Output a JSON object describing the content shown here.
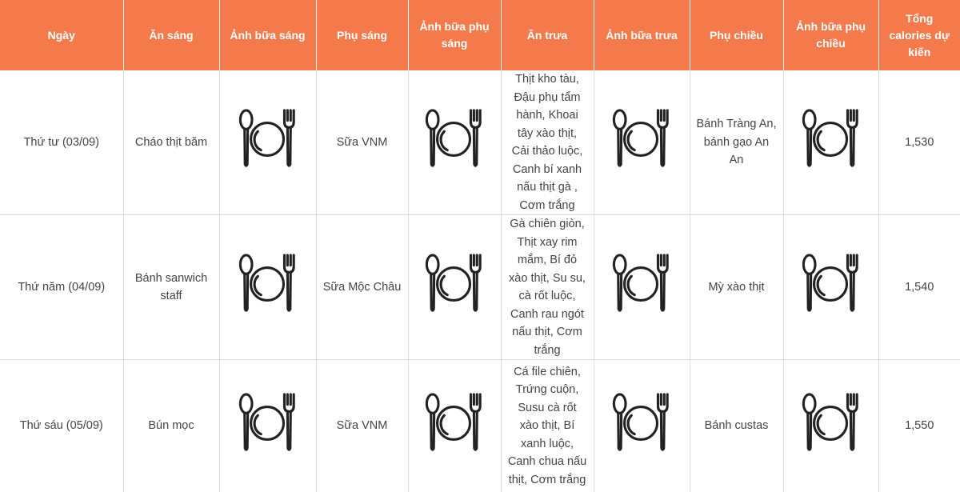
{
  "table": {
    "headers": [
      "Ngày",
      "Ăn sáng",
      "Ảnh bữa sáng",
      "Phụ sáng",
      "Ảnh bữa phụ sáng",
      "Ăn trưa",
      "Ảnh bữa trưa",
      "Phụ chiều",
      "Ảnh bữa phụ chiều",
      "Tổng calories dự kiến"
    ],
    "rows": [
      {
        "day": "Thứ tư (03/09)",
        "breakfast": "Cháo thịt băm",
        "breakfast_photo_icon": "plate-fork-spoon-icon",
        "morning_snack": "Sữa VNM",
        "morning_snack_photo_icon": "plate-fork-spoon-icon",
        "lunch": "Thịt kho tàu, Đậu phụ tẩm hành, Khoai tây xào thịt, Cải thảo luộc, Canh bí xanh nấu thịt gà , Cơm trắng",
        "lunch_photo_icon": "plate-fork-spoon-icon",
        "afternoon_snack": "Bánh Tràng An, bánh gạo An An",
        "afternoon_snack_photo_icon": "plate-fork-spoon-icon",
        "calories": "1,530"
      },
      {
        "day": "Thứ năm (04/09)",
        "breakfast": "Bánh sanwich staff",
        "breakfast_photo_icon": "plate-fork-spoon-icon",
        "morning_snack": "Sữa Mộc Châu",
        "morning_snack_photo_icon": "plate-fork-spoon-icon",
        "lunch": "Gà chiên giòn, Thịt xay rim mắm, Bí đỏ xào thịt, Su su, cà rốt luộc, Canh rau ngót nấu thịt, Cơm trắng",
        "lunch_photo_icon": "plate-fork-spoon-icon",
        "afternoon_snack": "Mỳ xào thịt",
        "afternoon_snack_photo_icon": "plate-fork-spoon-icon",
        "calories": "1,540"
      },
      {
        "day": "Thứ sáu (05/09)",
        "breakfast": "Bún mọc",
        "breakfast_photo_icon": "plate-fork-spoon-icon",
        "morning_snack": "Sữa VNM",
        "morning_snack_photo_icon": "plate-fork-spoon-icon",
        "lunch": "Cá file chiên, Trứng cuộn, Susu cà rốt xào thịt, Bí xanh luộc, Canh chua nấu thịt, Cơm trắng",
        "lunch_photo_icon": "plate-fork-spoon-icon",
        "afternoon_snack": "Bánh custas",
        "afternoon_snack_photo_icon": "plate-fork-spoon-icon",
        "calories": "1,550"
      }
    ]
  },
  "colors": {
    "header_bg": "#f47a4c",
    "header_text": "#ffffff",
    "cell_text": "#444444",
    "grid_line": "#dddddd",
    "icon_stroke": "#222222"
  }
}
